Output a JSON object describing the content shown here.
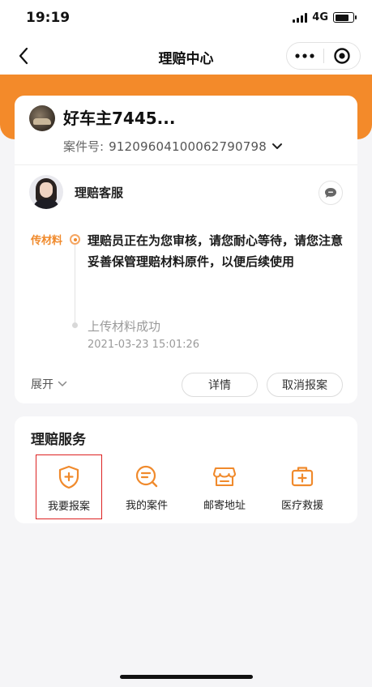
{
  "status": {
    "time": "19:19",
    "network": "4G"
  },
  "nav": {
    "title": "理赔中心"
  },
  "case": {
    "owner_name": "好车主7445...",
    "case_no_label": "案件号:",
    "case_no": "91209604100062790798"
  },
  "agent": {
    "name": "理赔客服"
  },
  "timeline": {
    "current_tag": "传材料",
    "current_message": "理赔员正在为您审核，请您耐心等待，请您注意妥善保管理赔材料原件，以便后续使用",
    "prev_title": "上传材料成功",
    "prev_time": "2021-03-23 15:01:26"
  },
  "actions": {
    "expand": "展开",
    "detail": "详情",
    "cancel": "取消报案"
  },
  "services": {
    "title": "理赔服务",
    "items": [
      {
        "label": "我要报案",
        "icon": "shield-plus-icon"
      },
      {
        "label": "我的案件",
        "icon": "list-search-icon"
      },
      {
        "label": "邮寄地址",
        "icon": "store-icon"
      },
      {
        "label": "医疗救援",
        "icon": "medical-kit-icon"
      }
    ]
  },
  "colors": {
    "accent": "#f38a2a",
    "highlight_border": "#dd2222"
  }
}
